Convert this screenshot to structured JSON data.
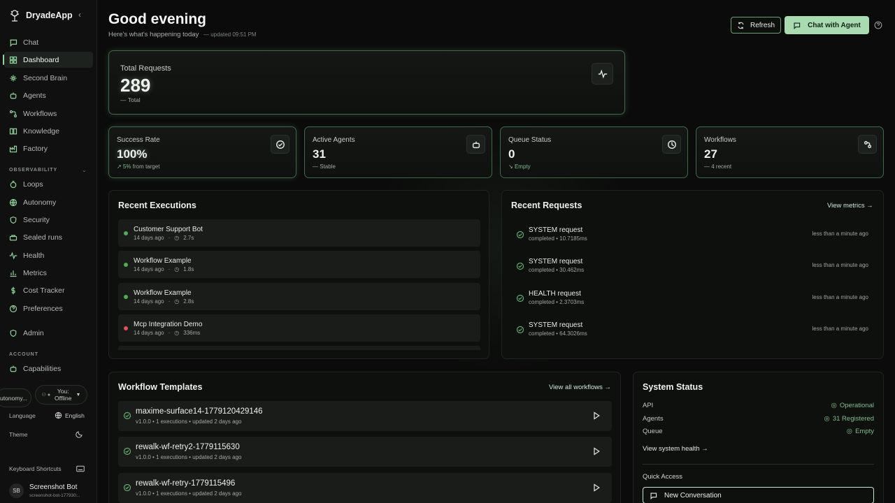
{
  "brand": {
    "name": "DryadeApp"
  },
  "sidebar": {
    "items": [
      {
        "label": "Chat",
        "icon": "chat-icon"
      },
      {
        "label": "Dashboard",
        "icon": "dashboard-icon",
        "active": true
      },
      {
        "label": "Second Brain",
        "icon": "brain-icon"
      },
      {
        "label": "Agents",
        "icon": "robot-icon"
      },
      {
        "label": "Workflows",
        "icon": "workflow-icon"
      },
      {
        "label": "Knowledge",
        "icon": "book-icon"
      },
      {
        "label": "Factory",
        "icon": "factory-icon"
      }
    ],
    "observability_label": "OBSERVABILITY",
    "observability_items": [
      {
        "label": "Loops",
        "icon": "loop-icon"
      },
      {
        "label": "Autonomy",
        "icon": "globe-icon"
      },
      {
        "label": "Security",
        "icon": "shield-icon"
      },
      {
        "label": "Sealed runs",
        "icon": "sealed-icon"
      },
      {
        "label": "Health",
        "icon": "pulse-icon"
      },
      {
        "label": "Metrics",
        "icon": "bar-chart-icon"
      },
      {
        "label": "Cost Tracker",
        "icon": "dollar-icon"
      },
      {
        "label": "Preferences",
        "icon": "help-circle-icon"
      }
    ],
    "admin": {
      "label": "Admin",
      "icon": "shield-icon"
    },
    "account_label": "ACCOUNT",
    "account_items": [
      {
        "label": "Capabilities",
        "icon": "robot-icon"
      }
    ],
    "autonomy_pill": "utonomy...",
    "status_pill_line1": "You:",
    "status_pill_line2": "Offline",
    "language_label": "Language",
    "language_value": "English",
    "theme_label": "Theme",
    "shortcuts_label": "Keyboard Shortcuts",
    "user": {
      "initials": "SB",
      "name": "Screenshot Bot",
      "sub": "screenshot-bot-177930..."
    }
  },
  "header": {
    "greeting": "Good evening",
    "subtitle": "Here's what's happening today",
    "updated": "— updated 09:51 PM",
    "refresh_label": "Refresh",
    "chat_label": "Chat with Agent"
  },
  "total_requests": {
    "label": "Total Requests",
    "value": "289",
    "note": "Total"
  },
  "stats": [
    {
      "label": "Success Rate",
      "value": "100%",
      "note_prefix": "↗ 5%",
      "note": "from target",
      "icon": "check-circle-icon"
    },
    {
      "label": "Active Agents",
      "value": "31",
      "note_prefix": "—",
      "note": "Stable",
      "icon": "robot-icon"
    },
    {
      "label": "Queue Status",
      "value": "0",
      "note_prefix": "↘",
      "note": "Empty",
      "icon": "clock-icon"
    },
    {
      "label": "Workflows",
      "value": "27",
      "note_prefix": "—",
      "note": "4 recent",
      "icon": "workflow-icon"
    }
  ],
  "recent_executions": {
    "title": "Recent Executions",
    "items": [
      {
        "name": "Customer Support Bot",
        "when": "14 days ago",
        "duration": "2.7s",
        "status": "success"
      },
      {
        "name": "Workflow Example",
        "when": "14 days ago",
        "duration": "1.8s",
        "status": "success"
      },
      {
        "name": "Workflow Example",
        "when": "14 days ago",
        "duration": "2.8s",
        "status": "success"
      },
      {
        "name": "Mcp Integration Demo",
        "when": "14 days ago",
        "duration": "336ms",
        "status": "failed"
      }
    ]
  },
  "recent_requests": {
    "title": "Recent Requests",
    "link": "View metrics →",
    "items": [
      {
        "name": "SYSTEM request",
        "meta": "completed • 10.7185ms",
        "time": "less than a minute ago"
      },
      {
        "name": "SYSTEM request",
        "meta": "completed • 30.462ms",
        "time": "less than a minute ago"
      },
      {
        "name": "HEALTH request",
        "meta": "completed • 2.3703ms",
        "time": "less than a minute ago"
      },
      {
        "name": "SYSTEM request",
        "meta": "completed • 64.3026ms",
        "time": "less than a minute ago"
      }
    ]
  },
  "workflow_templates": {
    "title": "Workflow Templates",
    "link": "View all workflows →",
    "items": [
      {
        "name": "maxime-surface14-1779120429146",
        "meta": "v1.0.0 • 1 executions • updated 2 days ago"
      },
      {
        "name": "rewalk-wf-retry2-1779115630",
        "meta": "v1.0.0 • 1 executions • updated 2 days ago"
      },
      {
        "name": "rewalk-wf-retry-1779115496",
        "meta": "v1.0.0 • 1 executions • updated 2 days ago"
      }
    ]
  },
  "system_status": {
    "title": "System Status",
    "rows": [
      {
        "label": "API",
        "value": "Operational"
      },
      {
        "label": "Agents",
        "value": "31 Registered"
      },
      {
        "label": "Queue",
        "value": "Empty"
      }
    ],
    "health_link": "View system health →",
    "quick_access": "Quick Access",
    "new_conversation": "New Conversation"
  },
  "colors": {
    "accent": "#8fd49a",
    "success": "#4caf50",
    "error": "#e05555",
    "chat_button": "#a8dcb0"
  }
}
